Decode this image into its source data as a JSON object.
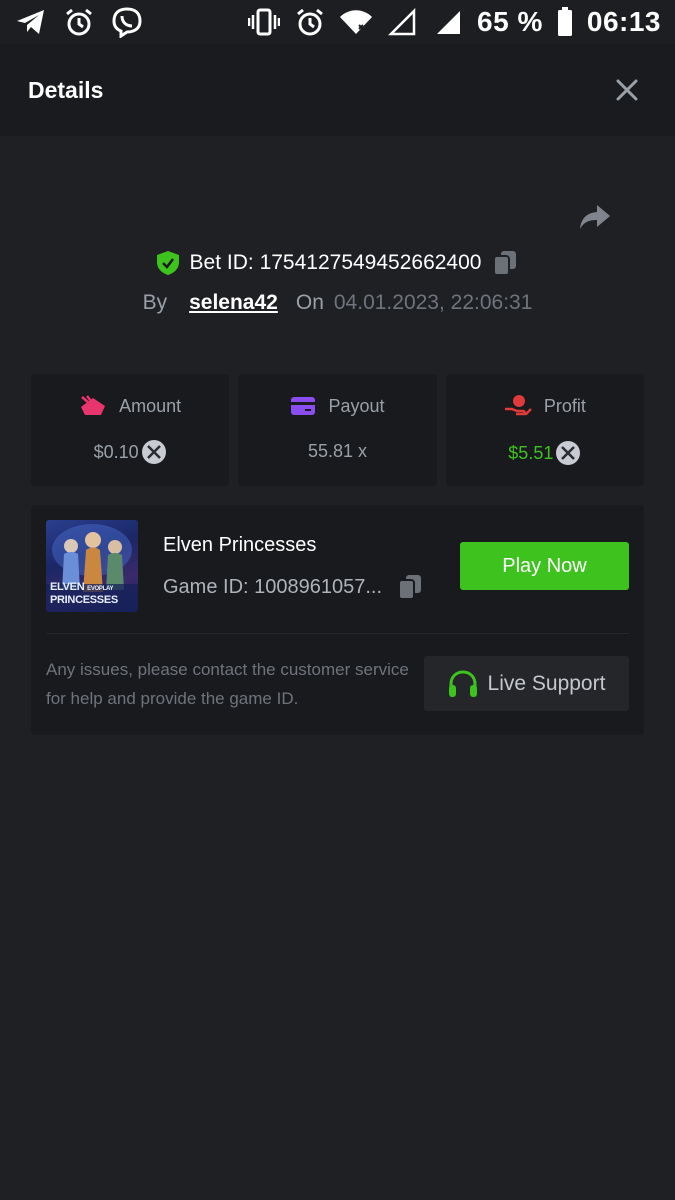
{
  "status_bar": {
    "battery": "65 %",
    "time": "06:13",
    "icons": [
      "telegram-icon",
      "alarm-icon",
      "viber-icon",
      "vibrate-icon",
      "alarm-icon",
      "wifi-icon",
      "signal-empty-icon",
      "signal-icon",
      "battery-icon"
    ]
  },
  "header": {
    "title": "Details",
    "close_icon": "close-icon"
  },
  "bet": {
    "prefix": "Bet ID:",
    "id": "1754127549452662400",
    "by_label": "By",
    "user": "selena42",
    "on_label": "On",
    "date": "04.01.2023, 22:06:31"
  },
  "stats": {
    "amount": {
      "label": "Amount",
      "value": "$0.10",
      "icon": "amount-icon"
    },
    "payout": {
      "label": "Payout",
      "value": "55.81 x",
      "icon": "card-icon"
    },
    "profit": {
      "label": "Profit",
      "value": "$5.51",
      "icon": "profit-hand-icon"
    }
  },
  "game": {
    "name": "Elven Princesses",
    "id_label": "Game ID: 1008961057...",
    "thumb_line1": "ELVEN",
    "thumb_line2": "PRINCESSES",
    "thumb_brand": "EVOPLAY",
    "play_label": "Play Now",
    "help_text": "Any issues, please contact the customer service for help and provide the game ID.",
    "support_label": "Live Support"
  },
  "colors": {
    "background": "#1f2024",
    "card": "#191a1d",
    "accent_green": "#3dc21e",
    "muted": "#9aa0a8"
  }
}
